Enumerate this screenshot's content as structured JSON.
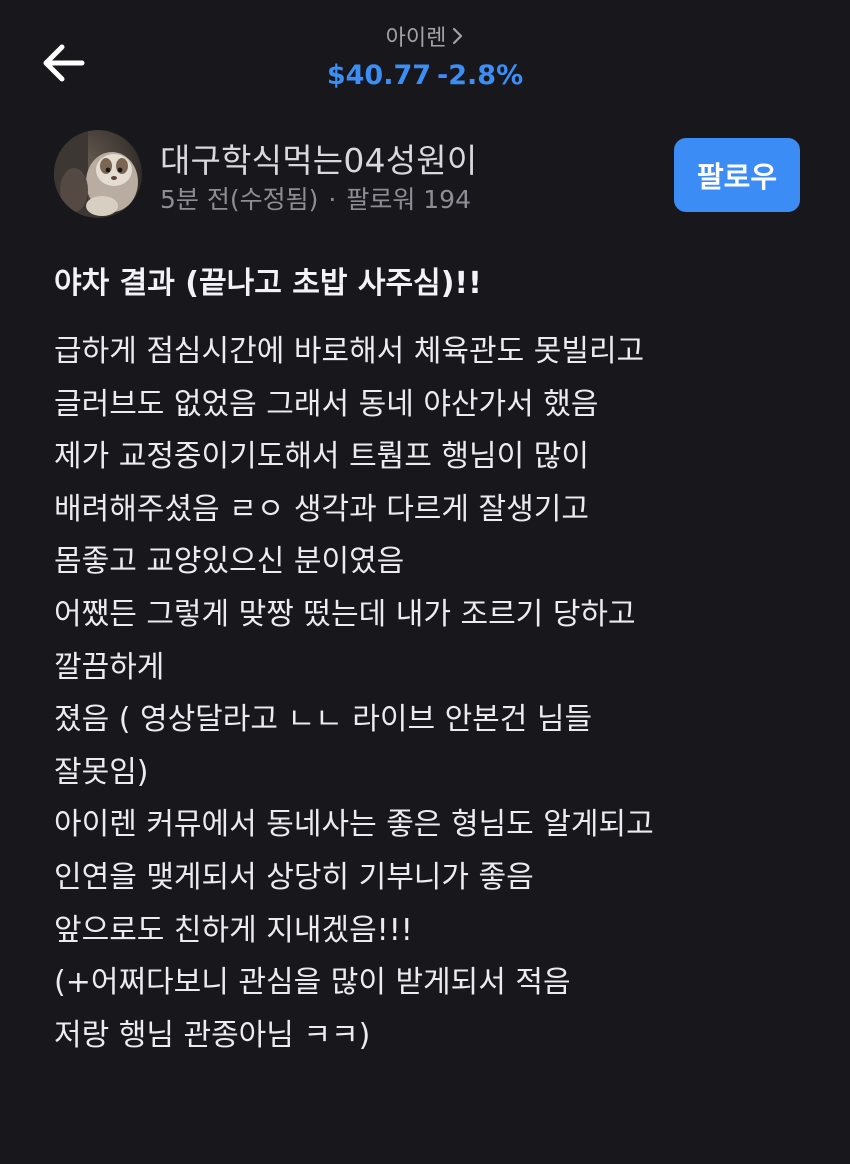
{
  "header": {
    "stock_name": "아이렌",
    "stock_price": "$40.77",
    "stock_change": "-2.8%",
    "accent_color": "#3a8ef6",
    "back_icon": "arrow-left-icon",
    "chevron_icon": "chevron-right-icon"
  },
  "author": {
    "name": "대구학식먹는04성원이",
    "time": "5분 전(수정됨)",
    "separator": "·",
    "followers": "팔로워 194",
    "follow_label": "팔로우"
  },
  "post": {
    "title": "야차 결과 (끝나고 초밥 사주심)!!",
    "lines": [
      "급하게 점심시간에 바로해서 체육관도 못빌리고",
      "글러브도 없었음 그래서 동네 야산가서 했음",
      "제가 교정중이기도해서 트뤔프 행님이 많이",
      "배려해주셨음 ㄹㅇ 생각과 다르게 잘생기고",
      "몸좋고 교양있으신 분이였음",
      "어쨌든 그렇게 맞짱 떴는데 내가 조르기 당하고",
      "깔끔하게",
      "졌음 ( 영상달라고 ㄴㄴ 라이브 안본건 님들",
      "잘못임)",
      "아이렌 커뮤에서 동네사는 좋은 형님도 알게되고",
      "인연을 맺게되서 상당히 기부니가 좋음",
      "앞으로도 친하게 지내겠음!!!",
      "(+어쩌다보니 관심을 많이 받게되서 적음",
      "저랑 행님 관종아님 ㅋㅋ)"
    ]
  }
}
